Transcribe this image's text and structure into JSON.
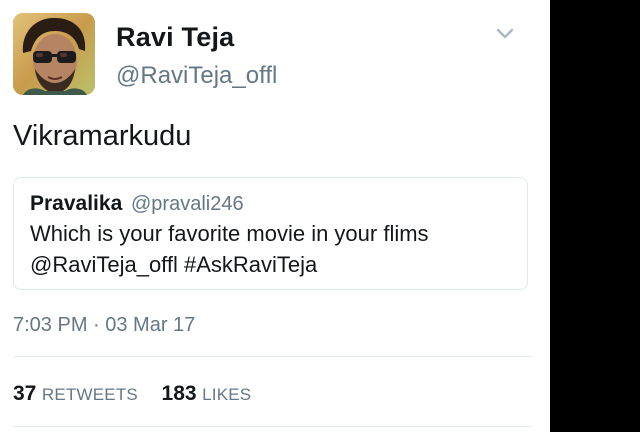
{
  "author": {
    "display_name": "Ravi Teja",
    "handle": "@RaviTeja_offl"
  },
  "tweet": {
    "text": "Vikramarkudu"
  },
  "quoted_tweet": {
    "display_name": "Pravalika",
    "handle": "@pravali246",
    "line1": "Which is your favorite movie in your flims",
    "line2": "@RaviTeja_offl #AskRaviTeja"
  },
  "timestamp": "7:03 PM · 03 Mar 17",
  "stats": {
    "retweets_count": "37",
    "retweets_label": "RETWEETS",
    "likes_count": "183",
    "likes_label": "LIKES"
  },
  "icons": {
    "menu": "chevron-down-icon",
    "avatar": "avatar-photo"
  },
  "colors": {
    "primary_text": "#14171a",
    "secondary_text": "#657786",
    "border": "#e1e8ed",
    "right_bar": "#000000"
  }
}
